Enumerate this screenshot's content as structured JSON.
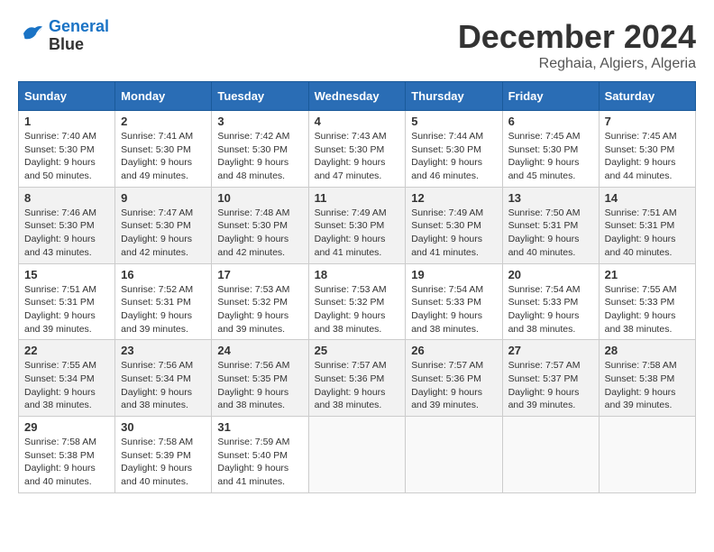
{
  "logo": {
    "line1": "General",
    "line2": "Blue"
  },
  "title": "December 2024",
  "location": "Reghaia, Algiers, Algeria",
  "headers": [
    "Sunday",
    "Monday",
    "Tuesday",
    "Wednesday",
    "Thursday",
    "Friday",
    "Saturday"
  ],
  "weeks": [
    [
      {
        "day": "1",
        "info": "Sunrise: 7:40 AM\nSunset: 5:30 PM\nDaylight: 9 hours\nand 50 minutes."
      },
      {
        "day": "2",
        "info": "Sunrise: 7:41 AM\nSunset: 5:30 PM\nDaylight: 9 hours\nand 49 minutes."
      },
      {
        "day": "3",
        "info": "Sunrise: 7:42 AM\nSunset: 5:30 PM\nDaylight: 9 hours\nand 48 minutes."
      },
      {
        "day": "4",
        "info": "Sunrise: 7:43 AM\nSunset: 5:30 PM\nDaylight: 9 hours\nand 47 minutes."
      },
      {
        "day": "5",
        "info": "Sunrise: 7:44 AM\nSunset: 5:30 PM\nDaylight: 9 hours\nand 46 minutes."
      },
      {
        "day": "6",
        "info": "Sunrise: 7:45 AM\nSunset: 5:30 PM\nDaylight: 9 hours\nand 45 minutes."
      },
      {
        "day": "7",
        "info": "Sunrise: 7:45 AM\nSunset: 5:30 PM\nDaylight: 9 hours\nand 44 minutes."
      }
    ],
    [
      {
        "day": "8",
        "info": "Sunrise: 7:46 AM\nSunset: 5:30 PM\nDaylight: 9 hours\nand 43 minutes."
      },
      {
        "day": "9",
        "info": "Sunrise: 7:47 AM\nSunset: 5:30 PM\nDaylight: 9 hours\nand 42 minutes."
      },
      {
        "day": "10",
        "info": "Sunrise: 7:48 AM\nSunset: 5:30 PM\nDaylight: 9 hours\nand 42 minutes."
      },
      {
        "day": "11",
        "info": "Sunrise: 7:49 AM\nSunset: 5:30 PM\nDaylight: 9 hours\nand 41 minutes."
      },
      {
        "day": "12",
        "info": "Sunrise: 7:49 AM\nSunset: 5:30 PM\nDaylight: 9 hours\nand 41 minutes."
      },
      {
        "day": "13",
        "info": "Sunrise: 7:50 AM\nSunset: 5:31 PM\nDaylight: 9 hours\nand 40 minutes."
      },
      {
        "day": "14",
        "info": "Sunrise: 7:51 AM\nSunset: 5:31 PM\nDaylight: 9 hours\nand 40 minutes."
      }
    ],
    [
      {
        "day": "15",
        "info": "Sunrise: 7:51 AM\nSunset: 5:31 PM\nDaylight: 9 hours\nand 39 minutes."
      },
      {
        "day": "16",
        "info": "Sunrise: 7:52 AM\nSunset: 5:31 PM\nDaylight: 9 hours\nand 39 minutes."
      },
      {
        "day": "17",
        "info": "Sunrise: 7:53 AM\nSunset: 5:32 PM\nDaylight: 9 hours\nand 39 minutes."
      },
      {
        "day": "18",
        "info": "Sunrise: 7:53 AM\nSunset: 5:32 PM\nDaylight: 9 hours\nand 38 minutes."
      },
      {
        "day": "19",
        "info": "Sunrise: 7:54 AM\nSunset: 5:33 PM\nDaylight: 9 hours\nand 38 minutes."
      },
      {
        "day": "20",
        "info": "Sunrise: 7:54 AM\nSunset: 5:33 PM\nDaylight: 9 hours\nand 38 minutes."
      },
      {
        "day": "21",
        "info": "Sunrise: 7:55 AM\nSunset: 5:33 PM\nDaylight: 9 hours\nand 38 minutes."
      }
    ],
    [
      {
        "day": "22",
        "info": "Sunrise: 7:55 AM\nSunset: 5:34 PM\nDaylight: 9 hours\nand 38 minutes."
      },
      {
        "day": "23",
        "info": "Sunrise: 7:56 AM\nSunset: 5:34 PM\nDaylight: 9 hours\nand 38 minutes."
      },
      {
        "day": "24",
        "info": "Sunrise: 7:56 AM\nSunset: 5:35 PM\nDaylight: 9 hours\nand 38 minutes."
      },
      {
        "day": "25",
        "info": "Sunrise: 7:57 AM\nSunset: 5:36 PM\nDaylight: 9 hours\nand 38 minutes."
      },
      {
        "day": "26",
        "info": "Sunrise: 7:57 AM\nSunset: 5:36 PM\nDaylight: 9 hours\nand 39 minutes."
      },
      {
        "day": "27",
        "info": "Sunrise: 7:57 AM\nSunset: 5:37 PM\nDaylight: 9 hours\nand 39 minutes."
      },
      {
        "day": "28",
        "info": "Sunrise: 7:58 AM\nSunset: 5:38 PM\nDaylight: 9 hours\nand 39 minutes."
      }
    ],
    [
      {
        "day": "29",
        "info": "Sunrise: 7:58 AM\nSunset: 5:38 PM\nDaylight: 9 hours\nand 40 minutes."
      },
      {
        "day": "30",
        "info": "Sunrise: 7:58 AM\nSunset: 5:39 PM\nDaylight: 9 hours\nand 40 minutes."
      },
      {
        "day": "31",
        "info": "Sunrise: 7:59 AM\nSunset: 5:40 PM\nDaylight: 9 hours\nand 41 minutes."
      },
      {
        "day": "",
        "info": ""
      },
      {
        "day": "",
        "info": ""
      },
      {
        "day": "",
        "info": ""
      },
      {
        "day": "",
        "info": ""
      }
    ]
  ]
}
